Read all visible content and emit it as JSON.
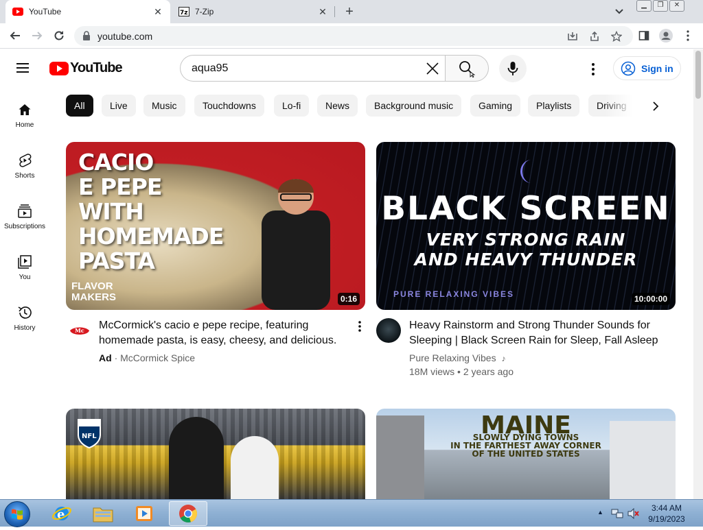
{
  "browser": {
    "tabs": [
      {
        "title": "YouTube",
        "active": true
      },
      {
        "title": "7-Zip",
        "active": false
      }
    ],
    "url": "youtube.com"
  },
  "youtube": {
    "logo_text": "YouTube",
    "search_query": "aqua95",
    "signin_label": "Sign in",
    "guide": [
      {
        "label": "Home",
        "icon": "home-icon"
      },
      {
        "label": "Shorts",
        "icon": "shorts-icon"
      },
      {
        "label": "Subscriptions",
        "icon": "subscriptions-icon"
      },
      {
        "label": "You",
        "icon": "you-icon"
      },
      {
        "label": "History",
        "icon": "history-icon"
      }
    ],
    "chips": [
      "All",
      "Live",
      "Music",
      "Touchdowns",
      "Lo-fi",
      "News",
      "Background music",
      "Gaming",
      "Playlists",
      "Driving"
    ],
    "videos": [
      {
        "title": "McCormick's cacio e pepe recipe, featuring homemade pasta, is easy, cheesy, and delicious.",
        "ad_label": "Ad",
        "channel": "McCormick Spice",
        "duration": "0:16",
        "thumb_text": "CACIO E PEPE WITH HOMEMADE PASTA",
        "thumb_brand": "FLAVOR MAKERS"
      },
      {
        "title": "Heavy Rainstorm and Strong Thunder Sounds for Sleeping | Black Screen Rain for Sleep, Fall Asleep",
        "channel": "Pure Relaxing Vibes",
        "views": "18M views",
        "age": "2 years ago",
        "duration": "10:00:00",
        "thumb_big": "BLACK SCREEN",
        "thumb_sub1": "VERY STRONG RAIN",
        "thumb_sub2": "AND HEAVY THUNDER",
        "thumb_tag": "PURE RELAXING VIBES"
      },
      {
        "thumb_logo": "NFL"
      },
      {
        "thumb_h1": "MAINE",
        "thumb_h2a": "SLOWLY DYING TOWNS",
        "thumb_h2b": "IN THE FARTHEST AWAY CORNER",
        "thumb_h2c": "OF THE UNITED STATES"
      }
    ]
  },
  "taskbar": {
    "time": "3:44 AM",
    "date": "9/19/2023"
  },
  "colors": {
    "youtube_red": "#ff0000",
    "link_blue": "#065fd4",
    "chip_selected": "#0f0f0f"
  }
}
